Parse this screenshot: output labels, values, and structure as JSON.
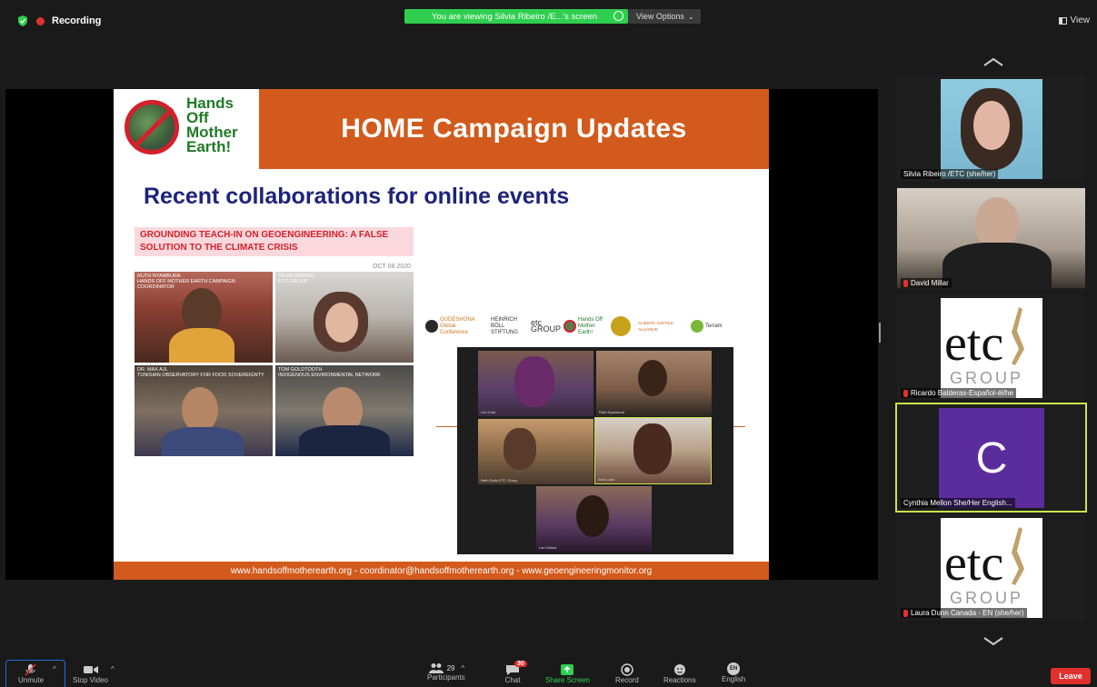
{
  "topbar": {
    "recording_label": "Recording",
    "share_banner": "You are viewing Silvia Ribeiro /E...'s screen",
    "view_options_label": "View Options",
    "view_label": "View"
  },
  "slide": {
    "logo_text": "Hands Off Mother Earth!",
    "header_title": "HOME Campaign Updates",
    "subtitle": "Recent collaborations for online events",
    "event_title": "GROUNDING TEACH-IN ON GEOENGINEERING: A FALSE SOLUTION TO THE CLIMATE CRISIS",
    "event_date": "OCT 08 2020",
    "teachin_tiles": [
      {
        "name": "RUTH NYAMBURA",
        "role": "Hands Off Mother Earth Campaign Coordinator"
      },
      {
        "name": "SILVIA RIBEIRO",
        "role": "ETC Group"
      },
      {
        "name": "DR. MAX AJL",
        "role": "Tunisian Observatory for Food Sovereignty"
      },
      {
        "name": "TOM GOLDTOOTH",
        "role": "Indigenous Environmental Network"
      }
    ],
    "sponsors": [
      "GUDESHONA Global Conference",
      "HEINRICH BÖLL STIFTUNG",
      "etc GROUP",
      "Hands Off Mother Earth!",
      "",
      "CLIMATE JUSTICE ALLIANCE",
      "Terram"
    ],
    "collab_tiles": [
      "Lim Chai",
      "Ruth Nyambura",
      "Neth Daño ETC Group",
      "Ana Lucia",
      "Lan Gelina"
    ],
    "footer": "www.handsoffmotherearth.org  -  coordinator@handsoffmotherearth.org  -  www.geoengineeringmonitor.org"
  },
  "participants_panel": {
    "tiles": [
      {
        "name": "Silvia Ribeiro /ETC (she/her)",
        "muted": false
      },
      {
        "name": "David Millar",
        "muted": true
      },
      {
        "name": "Ricardo Balderas-Español-él/he",
        "muted": true
      },
      {
        "name": "Cynthia Mellon She/Her English...",
        "muted": false,
        "initial": "C"
      },
      {
        "name": "Laura Dunn Canada - EN (she/her)",
        "muted": true
      }
    ],
    "etc_logo_word": "etc",
    "etc_logo_group": "GROUP"
  },
  "toolbar": {
    "unmute_label": "Unmute",
    "stop_video_label": "Stop Video",
    "participants_label": "Participants",
    "participants_count": "29",
    "chat_label": "Chat",
    "chat_badge": "30",
    "share_screen_label": "Share Screen",
    "record_label": "Record",
    "reactions_label": "Reactions",
    "english_label": "English",
    "english_icon_text": "EN",
    "leave_label": "Leave"
  },
  "colors": {
    "accent_orange": "#d25a1c",
    "share_green": "#2fce4f",
    "leave_red": "#e0312f",
    "active_speaker": "#c9e44b",
    "avatar_purple": "#5b2d9c"
  }
}
